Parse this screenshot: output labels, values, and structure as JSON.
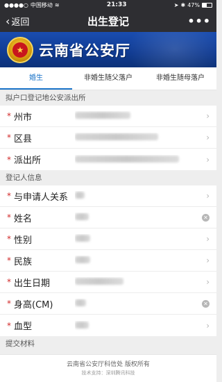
{
  "status_bar": {
    "carrier": "中国移动",
    "time": "21:33",
    "battery": "47%"
  },
  "nav": {
    "back_label": "返回",
    "title": "出生登记",
    "more_label": "•••"
  },
  "banner": {
    "title": "云南省公安厅"
  },
  "tabs": [
    {
      "label": "婚生",
      "active": true
    },
    {
      "label": "非婚生随父落户",
      "active": false
    },
    {
      "label": "非婚生随母落户",
      "active": false
    }
  ],
  "section1": {
    "title": "拟户口登记地公安派出所",
    "rows": [
      {
        "label": "州市",
        "required": true
      },
      {
        "label": "区县",
        "required": true
      },
      {
        "label": "派出所",
        "required": true
      }
    ]
  },
  "section2": {
    "title": "登记人信息",
    "rows": [
      {
        "label": "与申请人关系",
        "required": true
      },
      {
        "label": "姓名",
        "required": true
      },
      {
        "label": "性别",
        "required": true
      },
      {
        "label": "民族",
        "required": true
      },
      {
        "label": "出生日期",
        "required": true
      },
      {
        "label": "身高(CM)",
        "required": true
      },
      {
        "label": "血型",
        "required": true
      }
    ]
  },
  "section3": {
    "title": "提交材料"
  },
  "footer": {
    "line1": "云南省公安厅科信处 版权所有",
    "line2": "技术支持：深圳腾讯科技"
  }
}
